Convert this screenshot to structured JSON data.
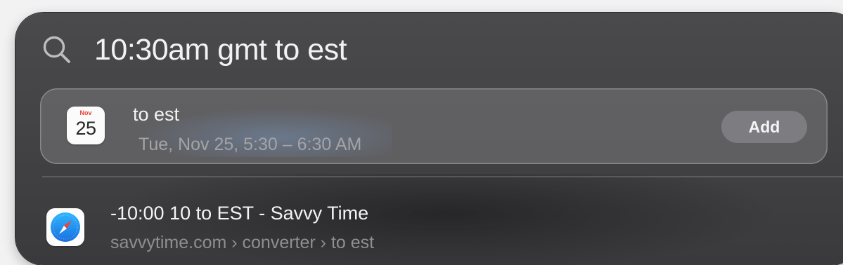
{
  "search": {
    "query": "10:30am gmt to est",
    "icon": "search-icon"
  },
  "calendar_result": {
    "icon": "calendar-icon",
    "icon_month": "Nov",
    "icon_day": "25",
    "title": "to est",
    "time": "Tue, Nov 25, 5:30 – 6:30 AM",
    "add_label": "Add"
  },
  "web_result": {
    "icon": "safari-icon",
    "title": "-10:00 10 to EST - Savvy Time",
    "url": "savvytime.com › converter › to est"
  },
  "colors": {
    "panel": "#454547",
    "calendar_month": "#e8403a",
    "safari_blue": "#1e90f0"
  }
}
